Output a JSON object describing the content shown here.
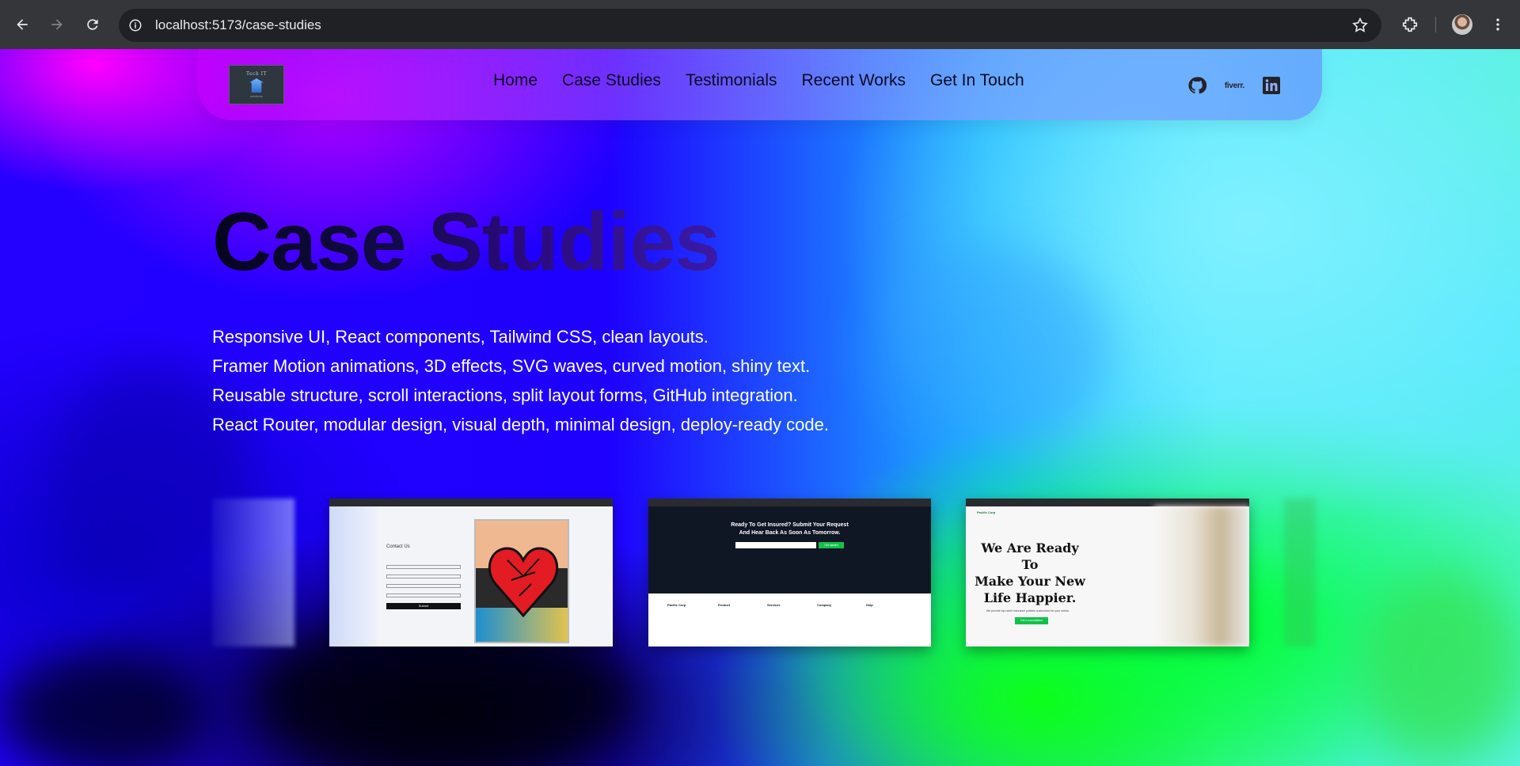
{
  "browser": {
    "url": "localhost:5173/case-studies"
  },
  "site": {
    "logo": {
      "title": "Tech IT",
      "subtitle": "solutions"
    },
    "nav": [
      "Home",
      "Case Studies",
      "Testimonials",
      "Recent Works",
      "Get In Touch"
    ],
    "socials": {
      "fiverr": "fiverr."
    }
  },
  "hero": {
    "title": "Case Studies",
    "lines": [
      "Responsive UI, React components, Tailwind CSS, clean layouts.",
      "Framer Motion animations, 3D effects, SVG waves, curved motion, shiny text.",
      "Reusable structure, scroll interactions, split layout forms, GitHub integration.",
      "React Router, modular design, visual depth, minimal design, deploy-ready code."
    ]
  },
  "cards": {
    "c1": {
      "form_title": "Contact Us",
      "submit": "Submit"
    },
    "c2": {
      "headline_1": "Ready To Get Insured? Submit Your Request",
      "headline_2": "And Hear Back As Soon As Tomorrow.",
      "button": "Get started",
      "brand": "Pacific Corp",
      "cols": [
        "Product",
        "Services",
        "Company",
        "Help"
      ]
    },
    "c3": {
      "brand": "Pacific Corp",
      "heading_1": "We Are Ready",
      "heading_2": "To",
      "heading_3": "Make Your New",
      "heading_4": "Life Happier.",
      "sub": "We provide top notch insurance policies customized for your needs.",
      "button": "Get a consultation"
    }
  }
}
